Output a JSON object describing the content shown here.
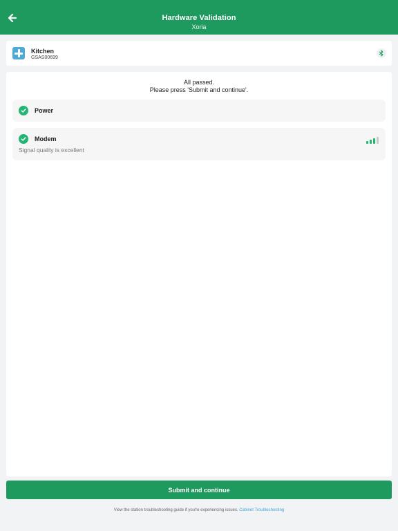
{
  "header": {
    "title": "Hardware Validation",
    "subtitle": "Xoria",
    "back_icon": "arrow-left-icon",
    "background": "#1f9a5f"
  },
  "device": {
    "name": "Kitchen",
    "serial": "GSAS00699",
    "icon": "plus-icon",
    "connection_icon": "bluetooth-icon"
  },
  "results": {
    "line1": "All passed.",
    "line2": "Please press 'Submit and continue'."
  },
  "checks": [
    {
      "label": "Power",
      "status": "passed"
    },
    {
      "label": "Modem",
      "status": "passed",
      "note": "Signal quality is excellent",
      "signal_bars_filled": 3,
      "signal_bars_total": 4
    }
  ],
  "submit": {
    "label": "Submit and continue"
  },
  "footer": {
    "text": "View the station troubleshooting guide if you're experiencing issues.",
    "link": "Cabinet Troubleshooting"
  },
  "colors": {
    "accent": "#1f9a5f",
    "success": "#22b573",
    "link": "#3fa6d6",
    "device_icon": "#4fa9d6"
  }
}
